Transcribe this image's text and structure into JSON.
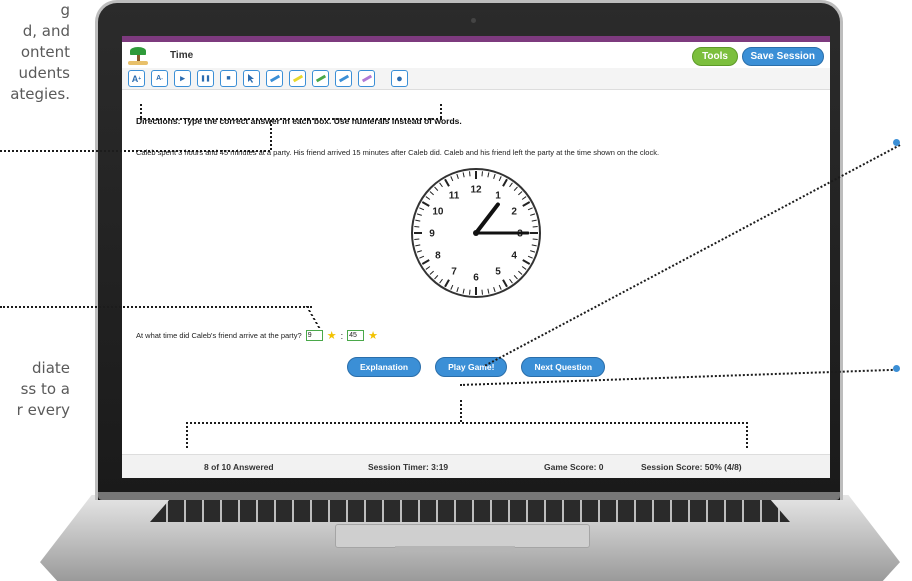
{
  "side_text": {
    "top": [
      "g",
      "d, and",
      "ontent",
      "udents",
      "ategies."
    ],
    "middle": [
      "diate",
      "ss to a",
      "r every"
    ]
  },
  "app": {
    "title": "Time",
    "tools_label": "Tools",
    "save_label": "Save Session"
  },
  "toolbar": {
    "font_up": "A",
    "font_down": "A",
    "play": "▸",
    "pause": "❚❚",
    "stop": "■",
    "highlighter_colors": [
      "#3b8fd6",
      "#e8d82c",
      "#4aa84a",
      "#3b8fd6",
      "#b07ad6"
    ],
    "record": "●"
  },
  "directions": "Directions: Type the correct answer in each box. Use numerals instead of words.",
  "problem": "Caleb spent 3 hours and 45 minutes at a party. His friend arrived 15 minutes after Caleb did. Caleb and his friend left the party at the time shown on the clock.",
  "clock": {
    "numbers": [
      "12",
      "1",
      "2",
      "3",
      "4",
      "5",
      "6",
      "7",
      "8",
      "9",
      "10",
      "11"
    ],
    "hour": 1,
    "minute": 15
  },
  "question": {
    "text": "At what time did Caleb's friend arrive at the party?",
    "hour_value": "9",
    "minute_value": "45"
  },
  "actions": {
    "explanation": "Explanation",
    "play_game": "Play Game!",
    "next_question": "Next Question"
  },
  "status": {
    "answered": "8 of 10 Answered",
    "timer": "Session Timer: 3:19",
    "game_score": "Game Score: 0",
    "session_score": "Session Score: 50% (4/8)"
  }
}
